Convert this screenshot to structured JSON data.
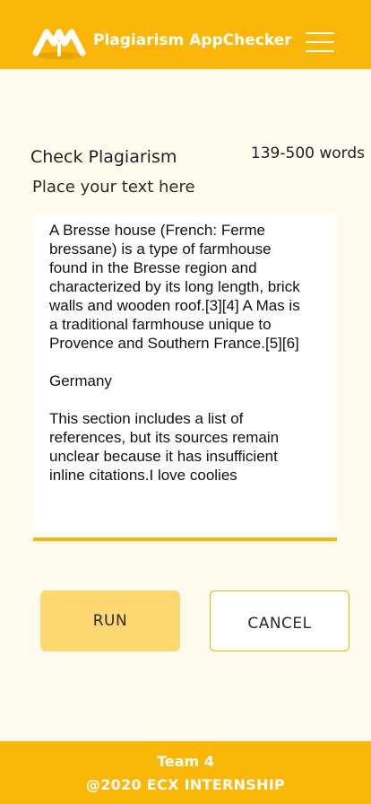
{
  "header": {
    "app_title": "Plagiarism AppChecker",
    "logo_icon": "mountain-logo-icon",
    "menu_icon": "hamburger-menu-icon",
    "color": "#FBB707"
  },
  "main": {
    "heading": "Check Plagiarism",
    "word_limit": "139-500 words",
    "input_label": "Place your text here",
    "text_value": "A Bresse house (French: Ferme bressane) is a type of farmhouse found in the Bresse region and characterized by its long length, brick walls and wooden roof.[3][4] A Mas is a traditional farmhouse unique to Provence and Southern France.[5][6]\n\nGermany\n\nThis section includes a list of references, but its sources remain unclear because it has insufficient inline citations.I love coolies"
  },
  "actions": {
    "run_label": "RUN",
    "cancel_label": "CANCEL"
  },
  "footer": {
    "team": "Team 4",
    "copyright": "@2020 ECX INTERNSHIP"
  },
  "colors": {
    "accent": "#FBB707",
    "run_button": "#FFD872",
    "background": "#FFFBEF"
  }
}
